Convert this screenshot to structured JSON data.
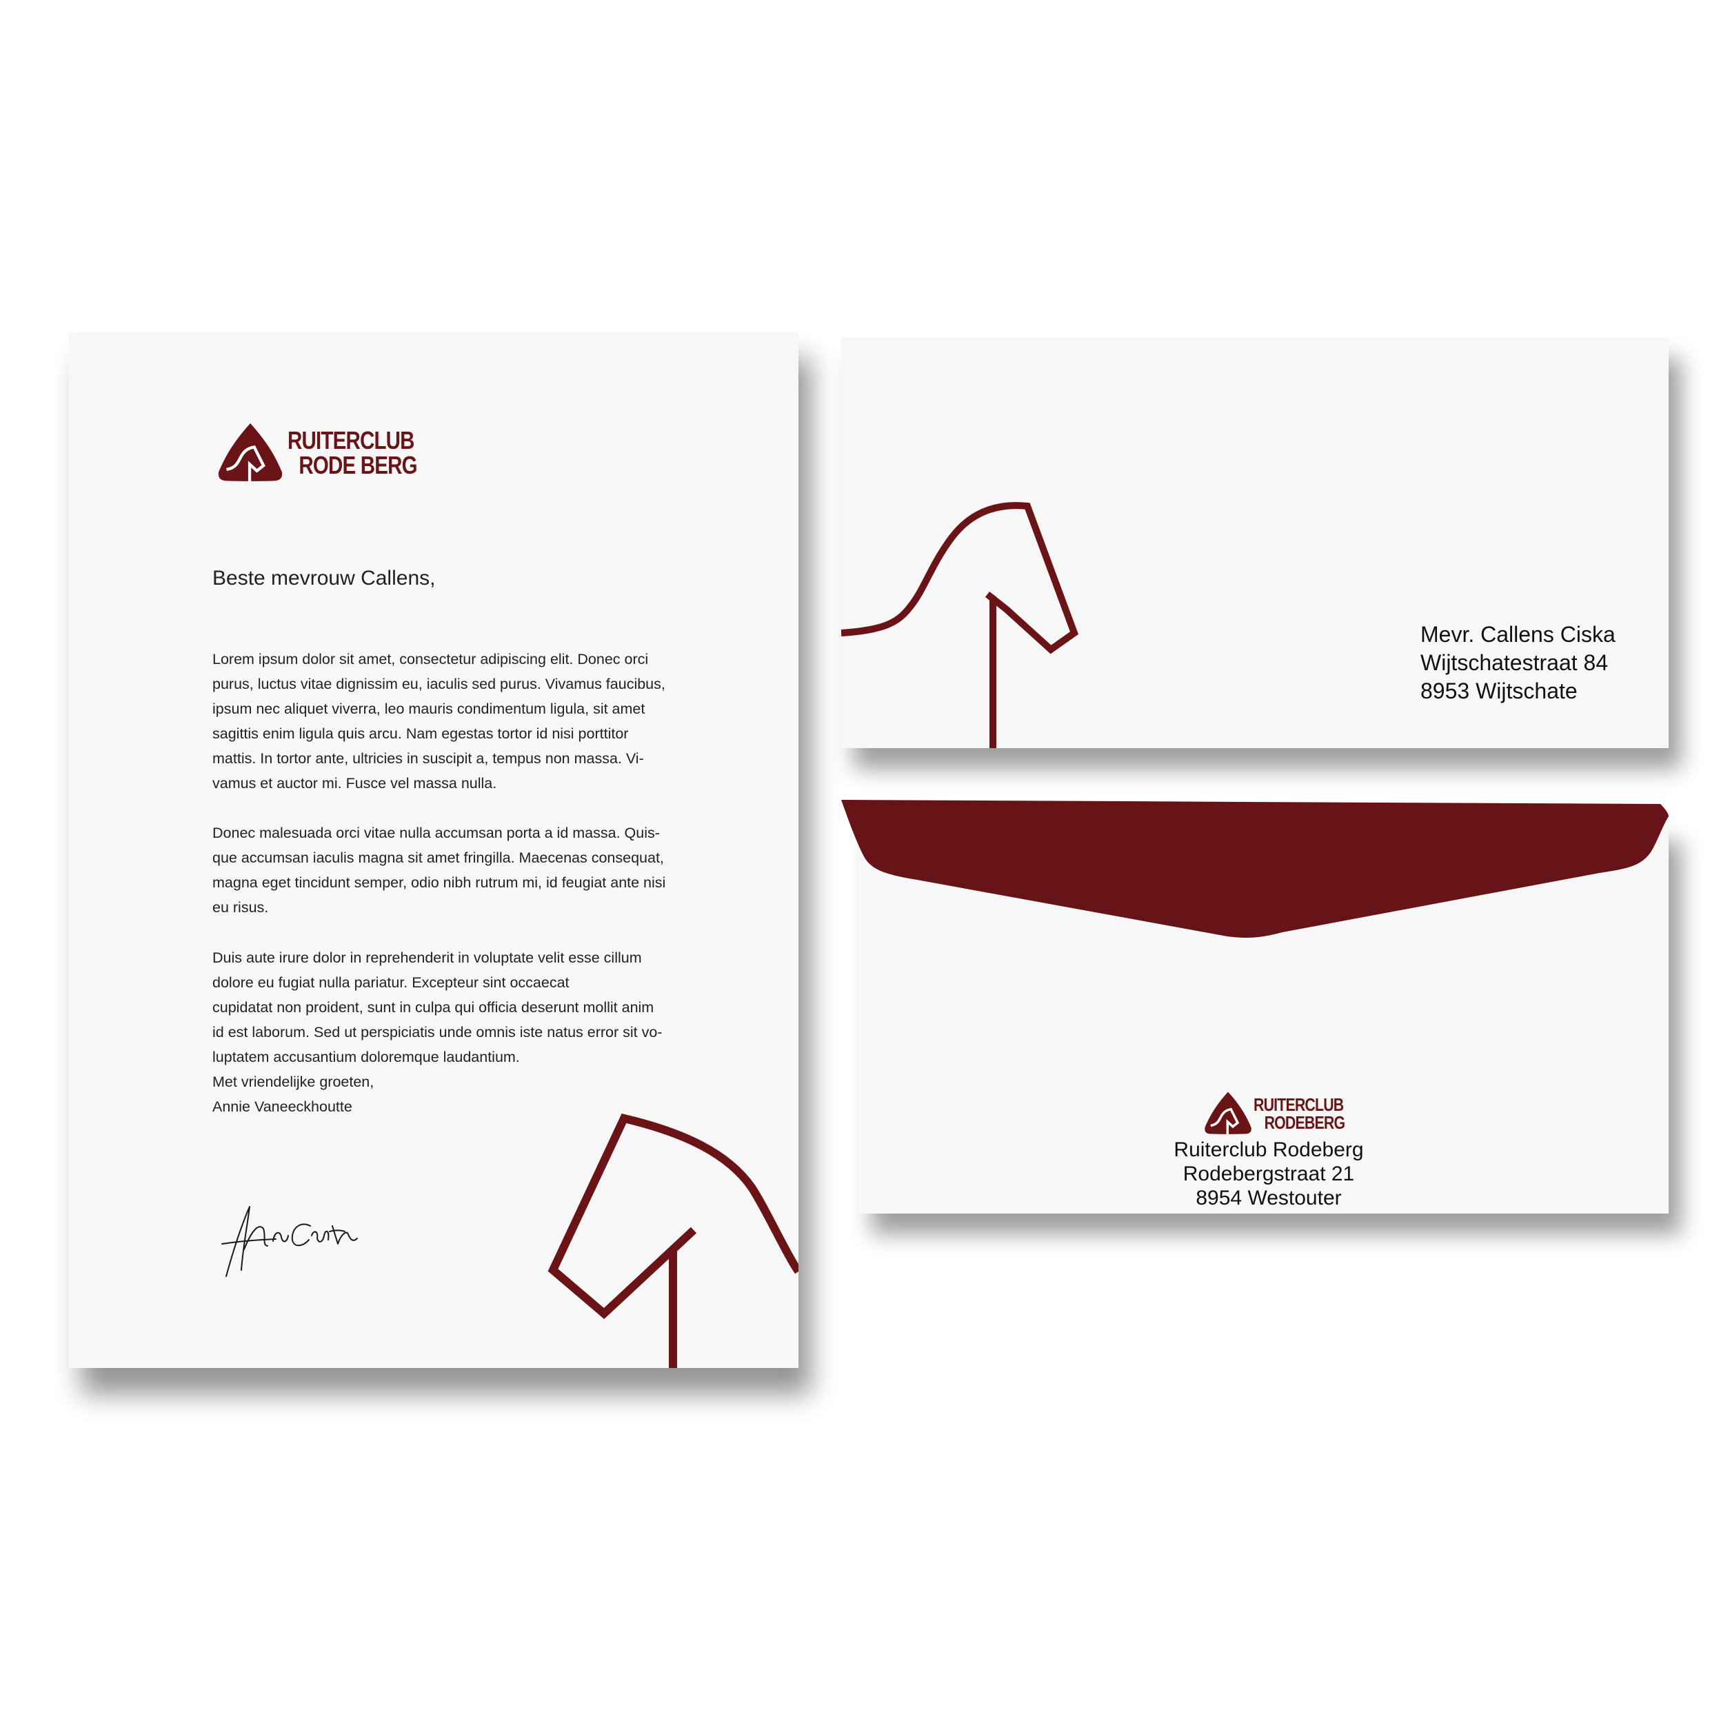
{
  "brand": {
    "color": "#6a1418",
    "logo_icon": "horse-head-shield-icon"
  },
  "letterhead": {
    "logo": {
      "line1": "RUITERCLUB",
      "line2": "RODE BERG"
    },
    "salutation": "Beste mevrouw Callens,",
    "paragraphs": [
      "Lorem ipsum dolor sit amet, consectetur adipiscing elit. Donec orci\npurus, luctus vitae dignissim eu, iaculis sed purus. Vivamus faucibus,\nipsum nec aliquet viverra, leo mauris condimentum ligula, sit amet\nsagittis enim ligula quis arcu. Nam egestas tortor id nisi porttitor\nmattis. In tortor ante, ultricies in suscipit a, tempus non massa. Vi-\nvamus et auctor mi. Fusce vel massa nulla.",
      "Donec malesuada orci vitae nulla accumsan porta a id massa. Quis-\nque accumsan iaculis magna sit amet fringilla. Maecenas consequat,\nmagna eget tincidunt semper, odio nibh rutrum mi, id feugiat ante nisi\neu risus.",
      "Duis aute irure dolor in reprehenderit in voluptate velit esse cillum\ndolore eu fugiat nulla pariatur. Excepteur sint occaecat\ncupidatat non proident, sunt in culpa qui officia deserunt mollit anim\nid est laborum. Sed ut perspiciatis unde omnis iste natus error sit vo-\nluptatem accusantium doloremque laudantium."
    ],
    "closing": "Met vriendelijke groeten,",
    "signer": "Annie Vaneeckhoutte",
    "signature_icon": "handwritten-signature"
  },
  "envelope_front": {
    "recipient": {
      "line1": "Mevr. Callens Ciska",
      "line2": "Wijtschatestraat 84",
      "line3": "8953 Wijtschate"
    }
  },
  "envelope_back": {
    "logo": {
      "line1": "RUITERCLUB",
      "line2": "RODEBERG"
    },
    "sender": {
      "line1": "Ruiterclub Rodeberg",
      "line2": "Rodebergstraat 21",
      "line3": "8954 Westouter"
    }
  }
}
